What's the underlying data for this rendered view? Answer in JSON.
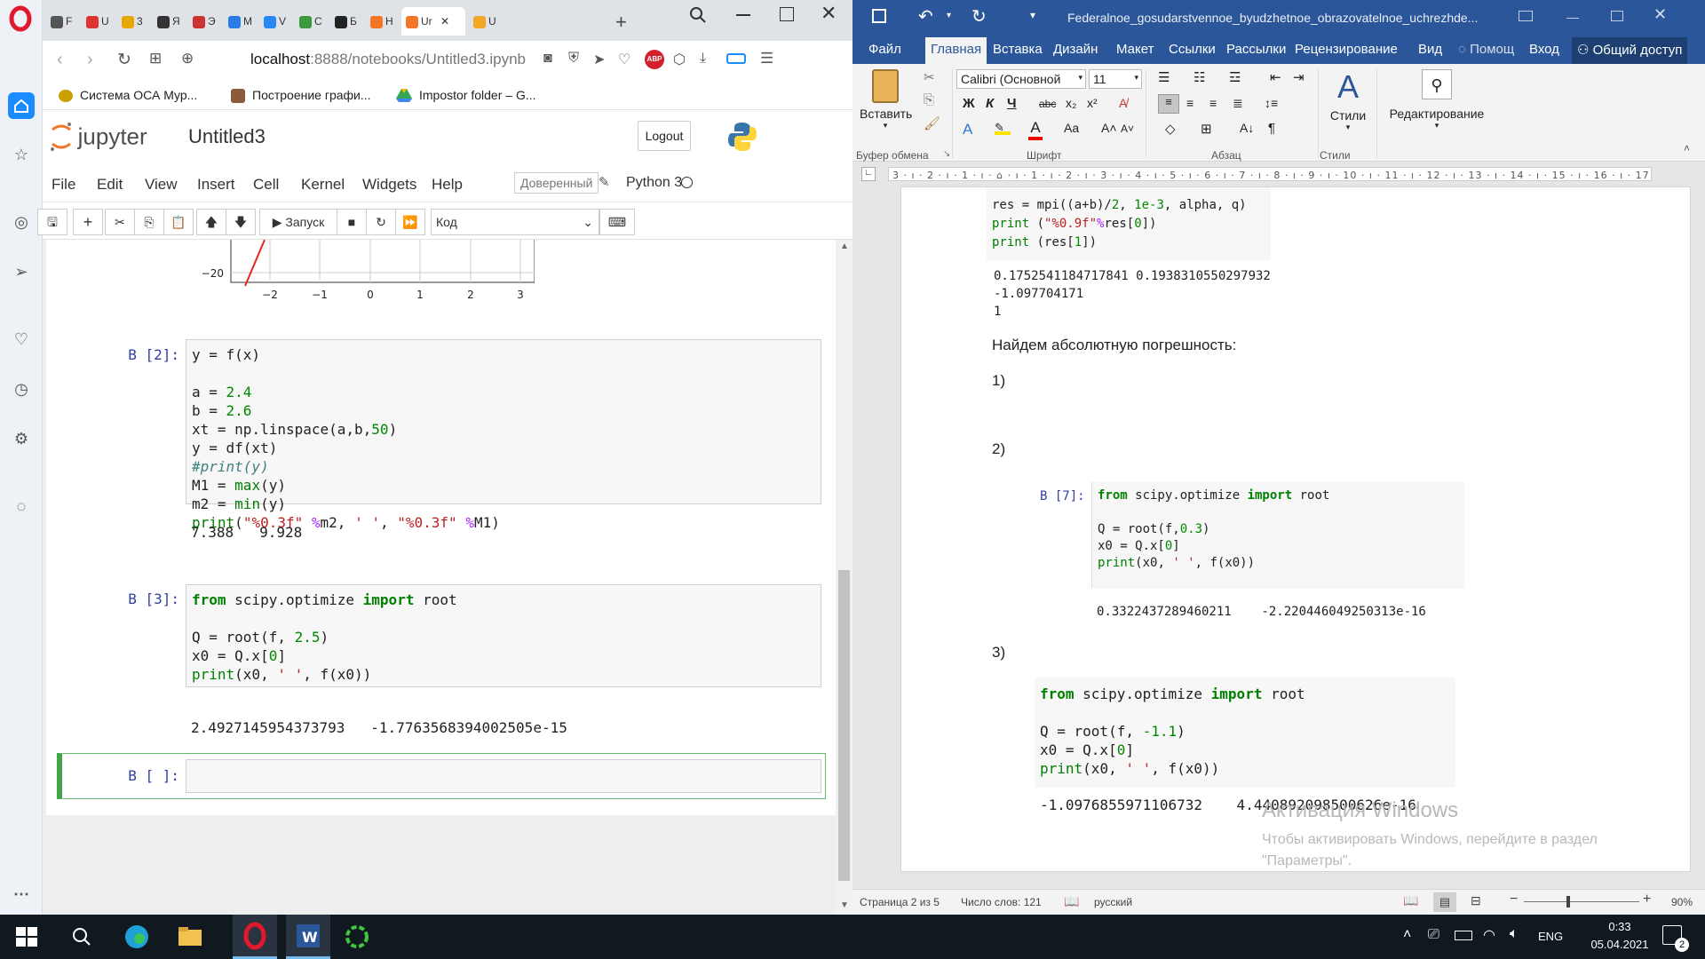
{
  "browser": {
    "tabs": [
      {
        "label": "F",
        "color": "#555555"
      },
      {
        "label": "U",
        "color": "#d33"
      },
      {
        "label": "3",
        "color": "#e8a600"
      },
      {
        "label": "Я",
        "color": "#333333"
      },
      {
        "label": "Э",
        "color": "#c33"
      },
      {
        "label": "M",
        "color": "#2a7be4"
      },
      {
        "label": "V",
        "color": "#2787f5"
      },
      {
        "label": "C",
        "color": "#3c9a3c"
      },
      {
        "label": "Б",
        "color": "#222222"
      },
      {
        "label": "H",
        "color": "#f37626"
      },
      {
        "label": "Ur",
        "color": "#f37626",
        "active": true
      },
      {
        "label": "U",
        "color": "#f3a626"
      }
    ],
    "url_host": "localhost",
    "url_rest": ":8888/notebooks/Untitled3.ipynb",
    "bookmarks": [
      "Система ОСА Мур...",
      "Построение графи...",
      "Impostor folder – G..."
    ]
  },
  "jupyter": {
    "logo_text": "jupyter",
    "notebook_name": "Untitled3",
    "logout": "Logout",
    "menu": [
      "File",
      "Edit",
      "View",
      "Insert",
      "Cell",
      "Kernel",
      "Widgets",
      "Help"
    ],
    "trusted": "Доверенный",
    "kernel": "Python 3",
    "run_label": "Запуск",
    "celltype": "Код",
    "plot": {
      "y_tick": "−20",
      "x_ticks": [
        "−2",
        "−1",
        "0",
        "1",
        "2",
        "3"
      ]
    },
    "cells": [
      {
        "prompt": "В [2]:",
        "output": "7.388   9.928"
      },
      {
        "prompt": "В [3]:",
        "output": "2.4927145954373793   -1.7763568394002505e-15"
      },
      {
        "prompt": "В [ ]:"
      }
    ]
  },
  "word": {
    "title": "Federalnoe_gosudarstvennoe_byudzhetnoe_obrazovatelnoe_uchrezhde...",
    "tabs": [
      "Файл",
      "Главная",
      "Вставка",
      "Дизайн",
      "Макет",
      "Ссылки",
      "Рассылки",
      "Рецензирование",
      "Вид",
      "Помощ",
      "Вход",
      "Общий доступ"
    ],
    "ribbon": {
      "paste": "Вставить",
      "font_name": "Calibri (Основной",
      "font_size": "11",
      "styles": "Стили",
      "editing": "Редактирование",
      "groups": [
        "Буфер обмена",
        "Шрифт",
        "Абзац",
        "Стили"
      ]
    },
    "doc": {
      "top_output_1": "0.1752541184717841 0.1938310550297932",
      "top_output_2": "-1.097704171",
      "top_output_3": "1",
      "heading": "Найдем абсолютную погрешность:",
      "item1": "1)",
      "item2": "2)",
      "item3": "3)",
      "cell7_prompt": "В [7]:",
      "cell7_output": "0.3322437289460211    -2.220446049250313e-16",
      "cell_last_output": "-1.0976855971106732    4.440892098500626e-16",
      "watermark1": "Активация Windows",
      "watermark2": "Чтобы активировать Windows, перейдите в раздел",
      "watermark3": "\"Параметры\"."
    },
    "status": {
      "page": "Страница 2 из 5",
      "words": "Число слов: 121",
      "lang": "русский",
      "zoom": "90%"
    }
  },
  "taskbar": {
    "lang": "ENG",
    "time": "0:33",
    "date": "05.04.2021",
    "notif_count": "2"
  }
}
